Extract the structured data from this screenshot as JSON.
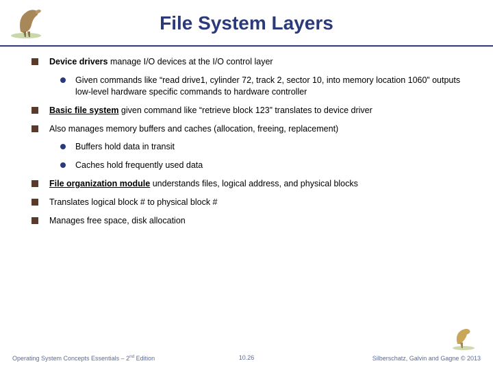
{
  "title": "File System Layers",
  "bullets": {
    "b1_bold": "Device drivers",
    "b1_rest": " manage I/O devices at the I/O control layer",
    "b1_sub1": "Given commands like “read drive1, cylinder 72, track 2, sector 10, into memory location 1060” outputs low-level hardware specific commands to hardware controller",
    "b2_bold": "Basic file system",
    "b2_rest": " given command like “retrieve block 123” translates to device driver",
    "b3": "Also manages memory buffers and caches (allocation, freeing, replacement)",
    "b3_sub1": "Buffers hold data in transit",
    "b3_sub2": "Caches hold frequently used data",
    "b4_bold": "File organization module",
    "b4_rest": " understands files, logical address, and physical blocks",
    "b5": "Translates logical block # to physical block #",
    "b6": "Manages free space, disk allocation"
  },
  "footer": {
    "left_a": "Operating System Concepts Essentials – 2",
    "left_b": " Edition",
    "center": "10.26",
    "right": "Silberschatz, Galvin and Gagne © 2013"
  }
}
